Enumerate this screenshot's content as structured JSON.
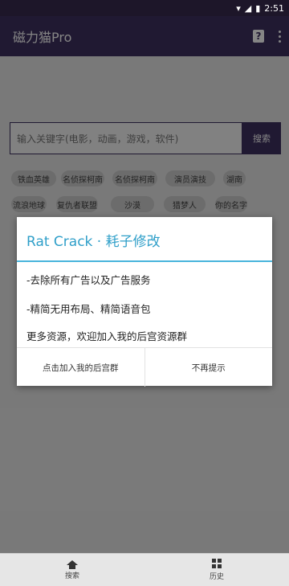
{
  "status_bar": {
    "time": "2:51"
  },
  "app_bar": {
    "title": "磁力猫Pro"
  },
  "search": {
    "placeholder": "输入关键字(电影，动画，游戏，软件)",
    "button": "搜索"
  },
  "chips": [
    "铁血英雄",
    "名侦探柯南",
    "名侦探柯南",
    "演员演技",
    "湖南",
    "流浪地球",
    "复仇者联盟",
    "沙漠",
    "猎梦人",
    "你的名字"
  ],
  "dialog": {
    "title": "Rat Crack · 耗子修改",
    "lines": [
      "-去除所有广告以及广告服务",
      "-精简无用布局、精简语音包",
      "更多资源，欢迎加入我的后宫资源群"
    ],
    "join_button": "点击加入我的后宫群",
    "dismiss_button": "不再提示"
  },
  "bottom_nav": [
    {
      "label": "搜索"
    },
    {
      "label": "历史"
    }
  ],
  "colors": {
    "primary": "#3f3060",
    "accent": "#2f9fc9",
    "divider": "#48b4dc"
  }
}
